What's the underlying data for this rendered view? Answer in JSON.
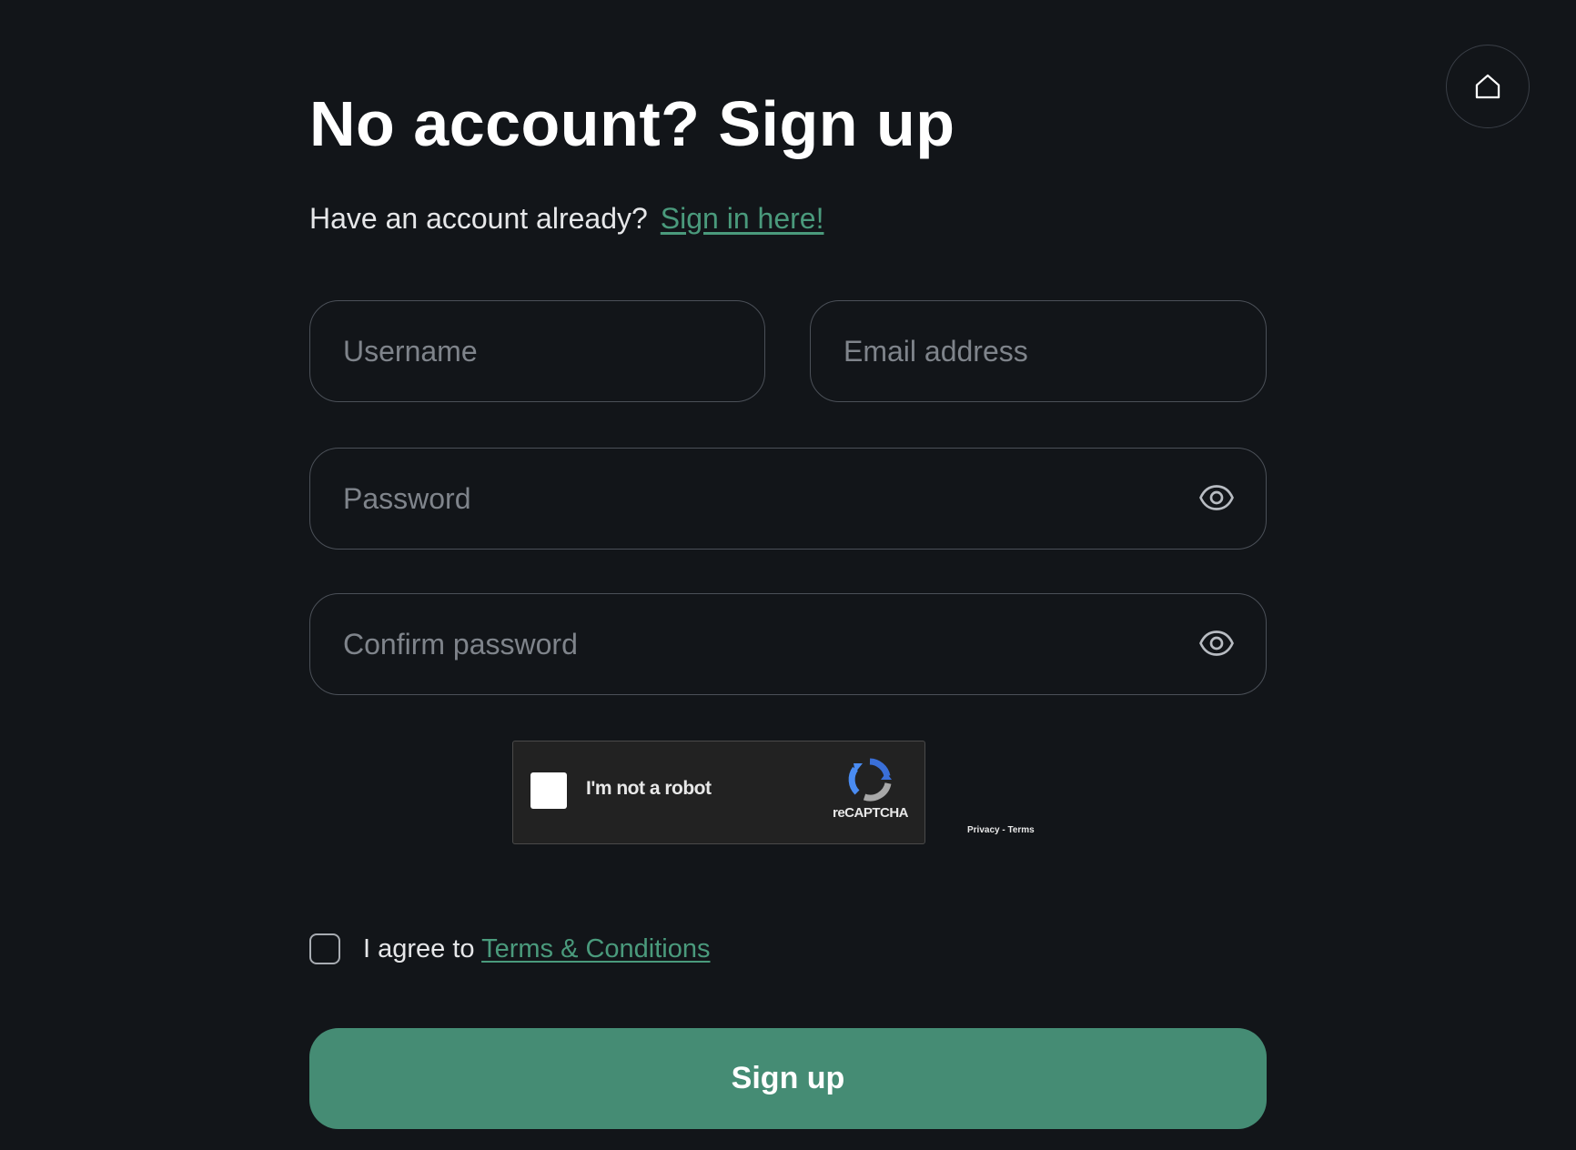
{
  "header": {
    "title": "No account? Sign up",
    "subtitle_text": "Have an account already?",
    "signin_link": "Sign in here!"
  },
  "nav": {
    "home_icon": "home-icon"
  },
  "fields": {
    "username": {
      "placeholder": "Username",
      "value": ""
    },
    "email": {
      "placeholder": "Email address",
      "value": ""
    },
    "password": {
      "placeholder": "Password",
      "value": "",
      "icon": "eye-icon"
    },
    "confirm_password": {
      "placeholder": "Confirm password",
      "value": "",
      "icon": "eye-icon"
    }
  },
  "captcha": {
    "label": "I'm not a robot",
    "brand": "reCAPTCHA",
    "links": "Privacy - Terms",
    "checked": false
  },
  "terms": {
    "prefix": "I agree to ",
    "link": "Terms & Conditions",
    "checked": false
  },
  "submit": {
    "label": "Sign up"
  },
  "colors": {
    "background": "#121519",
    "accent": "#458c74",
    "link": "#4a9a7c",
    "field_border": "#4b5058",
    "placeholder": "#7f848b"
  }
}
